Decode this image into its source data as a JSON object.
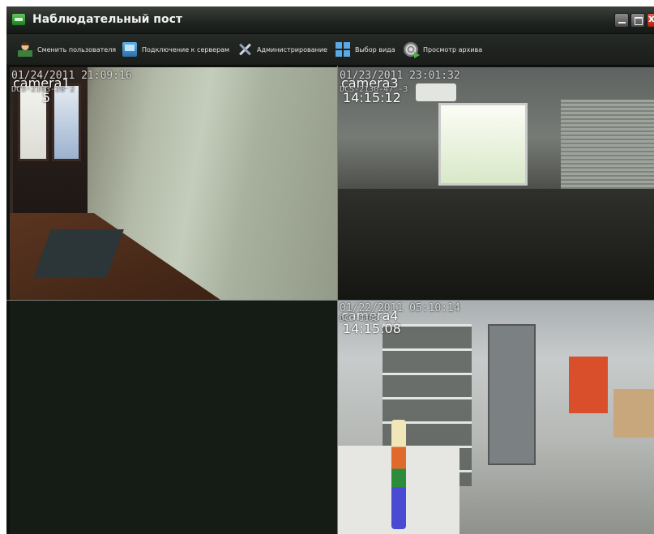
{
  "window": {
    "title": "Наблюдательный пост",
    "close_glyph": "x"
  },
  "toolbar": {
    "items": [
      {
        "label": "Сменить пользователя",
        "icon": "user-icon"
      },
      {
        "label": "Подключение к серверам",
        "icon": "server-icon"
      },
      {
        "label": "Администрирование",
        "icon": "tools-icon"
      },
      {
        "label": "Выбор вида",
        "icon": "layout-grid-icon"
      },
      {
        "label": "Просмотр архива",
        "icon": "archive-icon"
      }
    ]
  },
  "cameras": [
    {
      "name": "camera1",
      "timestamp": "01/24/2011 21:09:16",
      "sub": "DCS-2103-28 2",
      "time": "5"
    },
    {
      "name": "camera3",
      "timestamp": "01/23/2011 23:01:32",
      "sub": "DCS-2130-47 -3",
      "time": "14:15:12"
    },
    {
      "name": "",
      "timestamp": "",
      "sub": "",
      "time": ""
    },
    {
      "name": "camera4",
      "timestamp": "01/22/2011 05:10:14",
      "sub": "DCS-2103",
      "time": "14:15:08"
    }
  ],
  "colors": {
    "background": "#1b1f1b",
    "accent": "#5aa8e6",
    "close_button": "#d23a24"
  }
}
